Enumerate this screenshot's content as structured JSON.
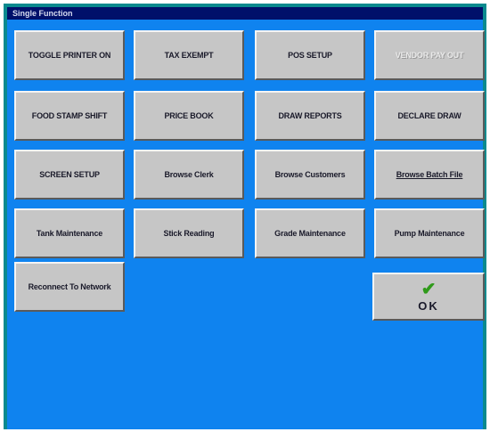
{
  "window": {
    "title": "Single Function"
  },
  "buttons": {
    "toggle_printer": "TOGGLE PRINTER ON",
    "tax_exempt": "TAX EXEMPT",
    "pos_setup": "POS SETUP",
    "vendor_pay_out": "VENDOR PAY OUT",
    "food_stamp_shift": "FOOD STAMP SHIFT",
    "price_book": "PRICE BOOK",
    "draw_reports": "DRAW REPORTS",
    "declare_draw": "DECLARE DRAW",
    "screen_setup": "SCREEN SETUP",
    "browse_clerk": "Browse Clerk",
    "browse_customers": "Browse Customers",
    "browse_batch_file": "Browse Batch File",
    "tank_maintenance": "Tank Maintenance",
    "stick_reading": "Stick Reading",
    "grade_maintenance": "Grade Maintenance",
    "pump_maintenance": "Pump Maintenance",
    "reconnect_network": "Reconnect To Network",
    "ok_check": "✔",
    "ok": "OK"
  },
  "colors": {
    "frame": "#0a8a8e",
    "title_bar": "#00106a",
    "panel": "#0f83ef",
    "button_face": "#c6c6c6",
    "ok_check": "#2f9a1a"
  }
}
